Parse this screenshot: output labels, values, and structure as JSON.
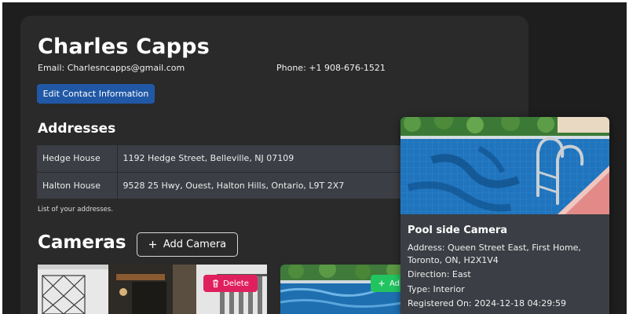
{
  "contact": {
    "name": "Charles Capps",
    "email": "Email: Charlesncapps@gmail.com",
    "phone": "Phone: +1 908-676-1521",
    "edit_label": "Edit Contact Information"
  },
  "addresses": {
    "title": "Addresses",
    "rows": [
      {
        "label": "Hedge House",
        "address": "1192 Hedge Street, Belleville, NJ 07109"
      },
      {
        "label": "Halton House",
        "address": "9528 25 Hwy, Ouest, Halton Hills, Ontario, L9T 2X7"
      }
    ],
    "caption": "List of your addresses."
  },
  "cameras": {
    "title": "Cameras",
    "add_label": "Add Camera",
    "delete_label": "Delete",
    "add_short_label": "Ad"
  },
  "popup": {
    "title": "Pool side Camera",
    "address_line1": "Address: Queen Street East, First Home,",
    "address_line2": "Toronto, ON, H2X1V4",
    "direction": "Direction: East",
    "type": "Type: Interior",
    "registered": "Registered On: 2024-12-18 04:29:59"
  },
  "colors": {
    "primary": "#2158a6",
    "danger": "#e0205e",
    "success": "#22c460",
    "card": "#2a2a2a"
  },
  "icons": {
    "add": "plus-icon",
    "delete": "trash-icon"
  }
}
